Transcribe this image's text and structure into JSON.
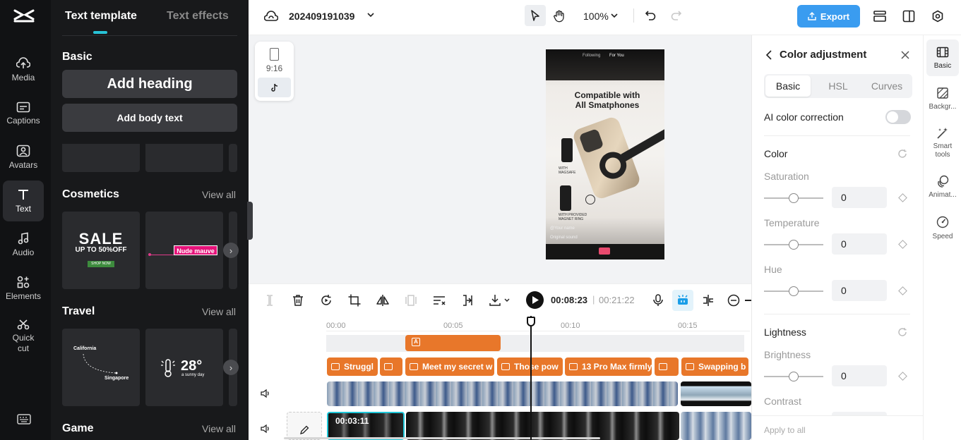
{
  "nav": {
    "items": [
      {
        "label": "Media",
        "icon": "cloud-upload-icon"
      },
      {
        "label": "Captions",
        "icon": "captions-icon"
      },
      {
        "label": "Avatars",
        "icon": "avatar-icon"
      },
      {
        "label": "Text",
        "icon": "text-icon"
      },
      {
        "label": "Audio",
        "icon": "music-note-icon"
      },
      {
        "label": "Elements",
        "icon": "elements-icon"
      },
      {
        "label": "Quick cut",
        "icon": "scissors-icon"
      }
    ],
    "active": "Text"
  },
  "text_panel": {
    "tabs": [
      "Text template",
      "Text effects"
    ],
    "basic_title": "Basic",
    "add_heading": "Add heading",
    "add_body": "Add body text",
    "sections": [
      {
        "title": "Cosmetics",
        "view_all": "View all"
      },
      {
        "title": "Travel",
        "view_all": "View all"
      },
      {
        "title": "Game",
        "view_all": "View all"
      }
    ],
    "cosmetics_cards": {
      "sale_big": "SALE",
      "sale_sub": "UP TO 50%OFF",
      "sale_btn": "SHOP NOW",
      "nude": "Nude mauve"
    },
    "travel_cards": {
      "from": "California",
      "to": "Singapore",
      "temp": "28°",
      "weather": "a sunny day"
    }
  },
  "topbar": {
    "project_name": "202409191039",
    "zoom": "100%",
    "export_label": "Export"
  },
  "preview": {
    "ratio_label": "9:16",
    "phone_tabs": [
      "Following",
      "For You"
    ],
    "headline_line1": "Compatible with",
    "headline_line2": "All Smatphones",
    "caption1": "WITH MAGSAFE",
    "caption2": "WITH PROVIDED MAGNET RING",
    "username": "@Your name",
    "sound": "Original sound"
  },
  "toolbar": {
    "current_time": "00:08:23",
    "total_time": "00:21:22"
  },
  "timeline": {
    "ruler": [
      "00:00",
      "00:05",
      "00:10",
      "00:15"
    ],
    "text_clips": [
      "Struggl",
      "",
      "Meet my secret w",
      "Those pow",
      "13 Pro Max firmly",
      "",
      "Swapping b"
    ],
    "main_clip_time": "00:03:11"
  },
  "right_panel": {
    "title": "Color adjustment",
    "tabs": [
      "Basic",
      "HSL",
      "Curves"
    ],
    "active_tab": "Basic",
    "ai_label": "AI color correction",
    "color_section": "Color",
    "saturation_label": "Saturation",
    "saturation_value": "0",
    "temperature_label": "Temperature",
    "temperature_value": "0",
    "hue_label": "Hue",
    "hue_value": "0",
    "lightness_section": "Lightness",
    "brightness_label": "Brightness",
    "brightness_value": "0",
    "contrast_label": "Contrast",
    "apply_all": "Apply to all"
  },
  "rail": {
    "items": [
      {
        "label": "Basic",
        "icon": "film-icon"
      },
      {
        "label": "Backgr...",
        "icon": "background-icon"
      },
      {
        "label": "Smart tools",
        "icon": "magic-wand-icon"
      },
      {
        "label": "Animat...",
        "icon": "animation-icon"
      },
      {
        "label": "Speed",
        "icon": "speed-icon"
      }
    ]
  },
  "colors": {
    "accent": "#1a9ee8",
    "export_bg": "#3a9cf0",
    "clip_orange": "#e8772a",
    "dark_bg": "#18191b"
  }
}
